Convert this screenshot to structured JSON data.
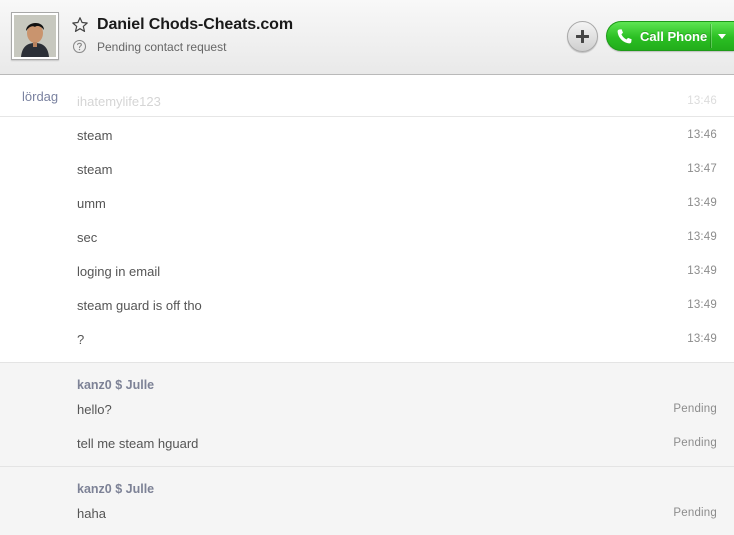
{
  "header": {
    "contact_name": "Daniel Chods-Cheats.com",
    "status": "Pending contact request",
    "add_button_icon": "plus-icon",
    "call_button_label": "Call Phone",
    "colors": {
      "call_green": "#2bbf23",
      "accent_text": "#7d8296"
    }
  },
  "conversation": {
    "day_label": "lördag",
    "faded_message": {
      "text": "ihatemylife123",
      "time": "13:46"
    },
    "incoming": [
      {
        "text": "steam",
        "time": "13:46"
      },
      {
        "text": "steam",
        "time": "13:47"
      },
      {
        "text": "umm",
        "time": "13:49"
      },
      {
        "text": "sec",
        "time": "13:49"
      },
      {
        "text": "loging in email",
        "time": "13:49"
      },
      {
        "text": "steam guard is off tho",
        "time": "13:49"
      },
      {
        "text": "?",
        "time": "13:49"
      }
    ],
    "outgoing_groups": [
      {
        "sender": "kanz0 $ Julle",
        "messages": [
          {
            "text": "hello?",
            "status": "Pending"
          },
          {
            "text": "tell me steam hguard",
            "status": "Pending"
          }
        ]
      },
      {
        "sender": "kanz0 $ Julle",
        "messages": [
          {
            "text": "haha",
            "status": "Pending"
          }
        ]
      }
    ]
  }
}
